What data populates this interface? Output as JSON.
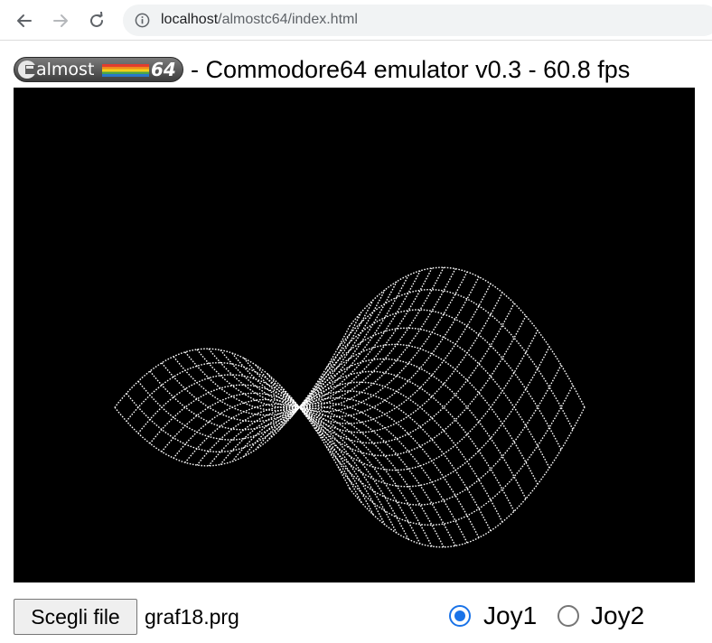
{
  "browser": {
    "url_host": "localhost",
    "url_path": "/almostc64/index.html"
  },
  "header": {
    "logo_text": "almost",
    "logo_number": "64",
    "title": "- Commodore64 emulator v0.3 - 60.8 fps"
  },
  "screen": {
    "background": "#000000",
    "content": "wireframe-saddle-surface"
  },
  "controls": {
    "file_button_label": "Scegli file",
    "file_name": "graf18.prg",
    "joy1_label": "Joy1",
    "joy2_label": "Joy2",
    "selected_joystick": "Joy1"
  },
  "colors": {
    "radio_accent": "#1a73e8",
    "wireframe": "#ffffff"
  }
}
